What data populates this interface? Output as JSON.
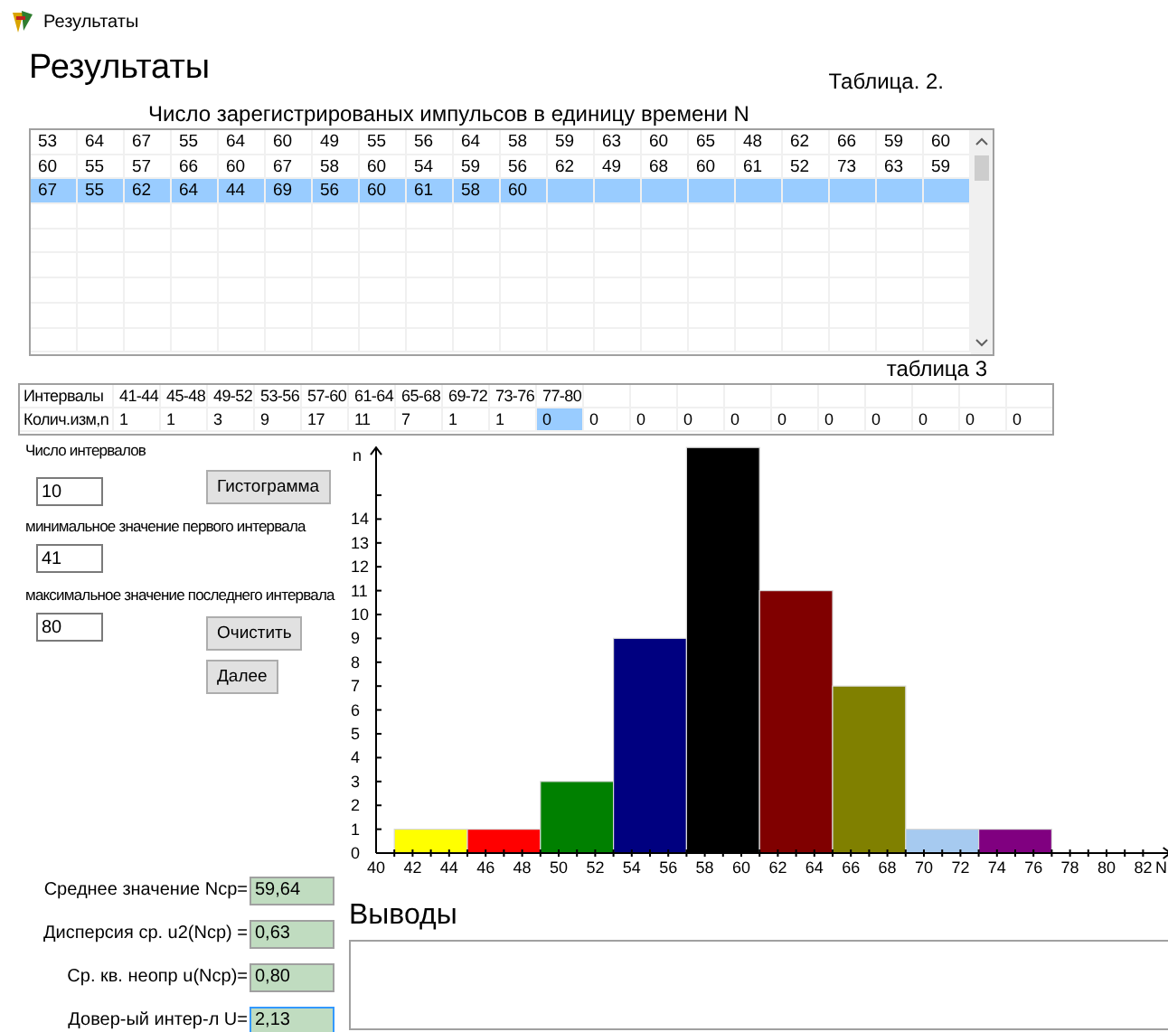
{
  "window": {
    "title": "Результаты"
  },
  "heading": "Результаты",
  "table2": {
    "label": "Таблица. 2.",
    "caption": "Число зарегистрированых импульсов в единицу времени N",
    "rows": [
      {
        "selected": false,
        "cells": [
          "53",
          "64",
          "67",
          "55",
          "64",
          "60",
          "49",
          "55",
          "56",
          "64",
          "58",
          "59",
          "63",
          "60",
          "65",
          "48",
          "62",
          "66",
          "59",
          "60"
        ]
      },
      {
        "selected": false,
        "cells": [
          "60",
          "55",
          "57",
          "66",
          "60",
          "67",
          "58",
          "60",
          "54",
          "59",
          "56",
          "62",
          "49",
          "68",
          "60",
          "61",
          "52",
          "73",
          "63",
          "59"
        ]
      },
      {
        "selected": true,
        "cells": [
          "67",
          "55",
          "62",
          "64",
          "44",
          "69",
          "56",
          "60",
          "61",
          "58",
          "60"
        ]
      }
    ]
  },
  "table3": {
    "label": "таблица 3",
    "intervals_header": "Интервалы",
    "intervals": [
      "41-44",
      "45-48",
      "49-52",
      "53-56",
      "57-60",
      "61-64",
      "65-68",
      "69-72",
      "73-76",
      "77-80"
    ],
    "counts_header": "Колич.изм,n",
    "counts": [
      {
        "text": "1",
        "selected": false
      },
      {
        "text": "1",
        "selected": false
      },
      {
        "text": "3",
        "selected": false
      },
      {
        "text": "9",
        "selected": false
      },
      {
        "text": "17",
        "selected": false
      },
      {
        "text": "11",
        "selected": false
      },
      {
        "text": "7",
        "selected": false
      },
      {
        "text": "1",
        "selected": false
      },
      {
        "text": "1",
        "selected": false
      },
      {
        "text": "0",
        "selected": true
      },
      {
        "text": "0",
        "selected": false
      },
      {
        "text": "0",
        "selected": false
      },
      {
        "text": "0",
        "selected": false
      },
      {
        "text": "0",
        "selected": false
      },
      {
        "text": "0",
        "selected": false
      },
      {
        "text": "0",
        "selected": false
      },
      {
        "text": "0",
        "selected": false
      },
      {
        "text": "0",
        "selected": false
      },
      {
        "text": "0",
        "selected": false
      },
      {
        "text": "0",
        "selected": false
      }
    ]
  },
  "controls": {
    "intervals_label": "Число интервалов",
    "intervals_value": "10",
    "min_label": "минимальное значение первого интервала",
    "min_value": "41",
    "max_label": "максимальное значение последнего интервала",
    "max_value": "80",
    "buttons": [
      "Гистограмма",
      "Очистить",
      "Далее"
    ]
  },
  "histogram": {
    "chart_data": {
      "type": "bar",
      "xlabel": "N",
      "ylabel": "n",
      "x": [
        43,
        47,
        51,
        55,
        59,
        63,
        67,
        71,
        75
      ],
      "values": [
        1,
        1,
        3,
        9,
        17,
        11,
        7,
        1,
        1
      ],
      "colors": [
        "#ffff00",
        "#ff0000",
        "#008000",
        "#000080",
        "#000000",
        "#800000",
        "#808000",
        "#a6caf0",
        "#800080"
      ],
      "xlim": [
        40,
        83.5
      ],
      "ylim": [
        0,
        17
      ],
      "xticks": [
        40,
        42,
        44,
        46,
        48,
        50,
        52,
        54,
        56,
        58,
        60,
        62,
        64,
        66,
        68,
        70,
        72,
        74,
        76,
        78,
        80,
        82
      ],
      "yticks": [
        0,
        1,
        2,
        3,
        4,
        5,
        6,
        7,
        8,
        9,
        10,
        11,
        12,
        13,
        14
      ]
    }
  },
  "stats": [
    {
      "label": "Среднее значение Nср=",
      "value": "59,64",
      "focused": false
    },
    {
      "label": "Дисперсия ср. u2(Nср) =",
      "value": "0,63",
      "focused": false
    },
    {
      "label": "Ср. кв. неопр u(Nср)=",
      "value": "0,80",
      "focused": false
    },
    {
      "label": "Довер-ый интер-л U=",
      "value": "2,13",
      "focused": true
    }
  ],
  "conclusions": {
    "title": "Выводы"
  }
}
